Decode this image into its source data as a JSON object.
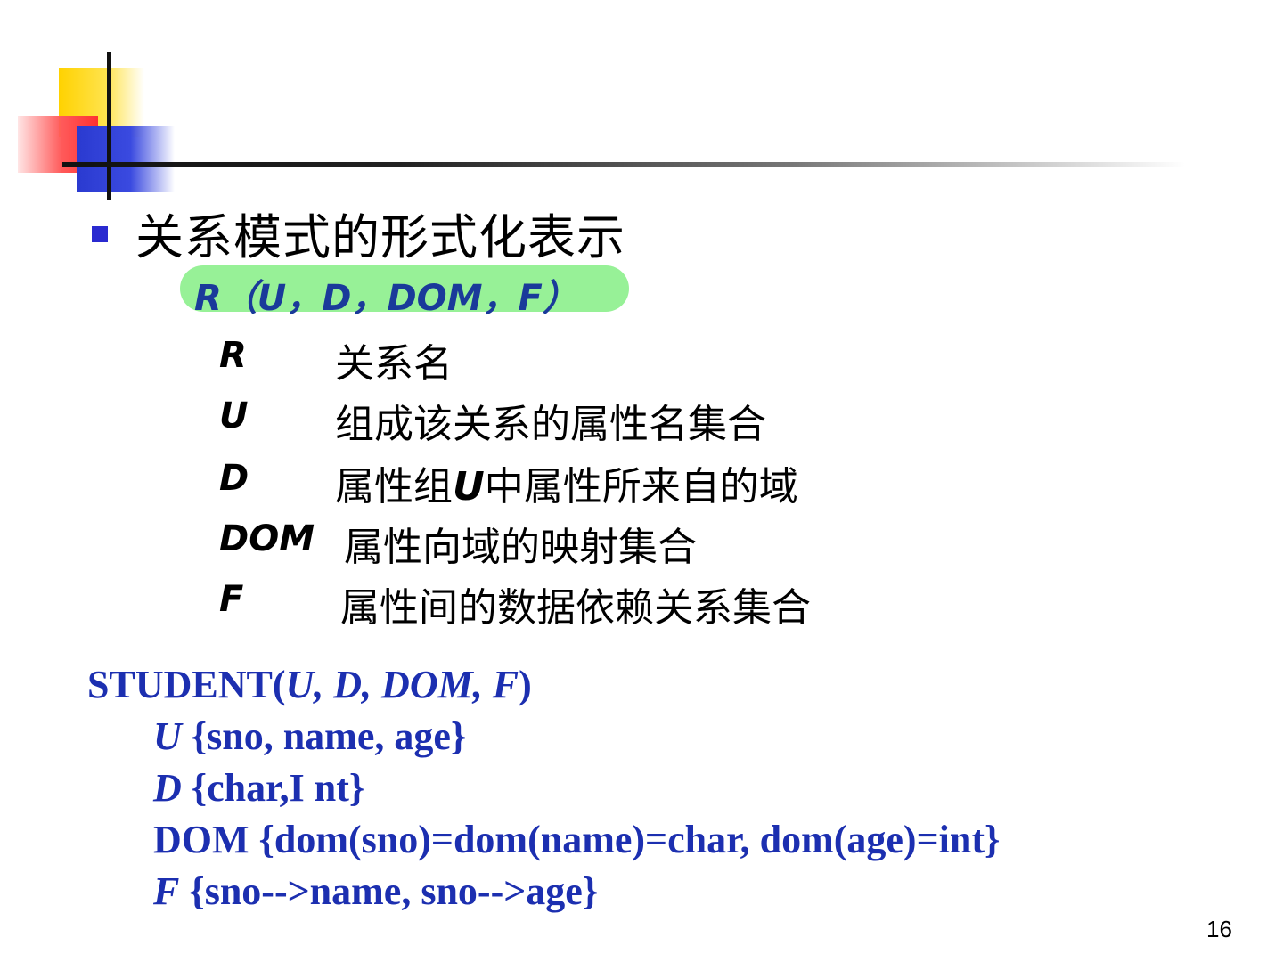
{
  "slide": {
    "title": "关系模式的形式化表示",
    "formula": "R（U，D，DOM，F）",
    "definitions": [
      {
        "symbol": "R",
        "text": "关系名"
      },
      {
        "symbol": "U",
        "text": "组成该关系的属性名集合"
      },
      {
        "symbol": "D",
        "text_before": "属性组",
        "text_italic": "U",
        "text_after": "中属性所来自的域"
      },
      {
        "symbol": "DOM",
        "text": "属性向域的映射集合"
      },
      {
        "symbol": "F",
        "text": "属性间的数据依赖关系集合"
      }
    ],
    "example": {
      "head_prefix": "STUDENT(",
      "head_args": "U, D, DOM, F",
      "head_suffix": ")",
      "lines": [
        {
          "sym": "U",
          "italic": true,
          "body": " {sno, name, age}"
        },
        {
          "sym": "D",
          "italic": true,
          "body": " {char,I nt}"
        },
        {
          "sym": "DOM",
          "italic": false,
          "body": " {dom(sno)=dom(name)=char,  dom(age)=int}"
        },
        {
          "sym": "F",
          "italic": true,
          "body": " {sno-->name, sno-->age}"
        }
      ]
    },
    "page_number": "16"
  },
  "colors": {
    "accent_blue": "#1c2fb0",
    "formula_blue": "#1a3a9a",
    "highlight_green": "#8cf08c",
    "bullet_blue": "#2a2ad0"
  }
}
